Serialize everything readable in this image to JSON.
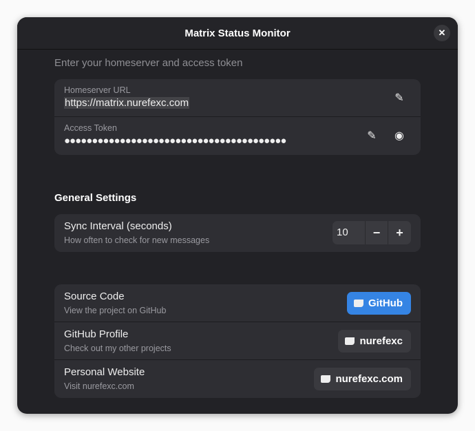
{
  "window": {
    "title": "Matrix Status Monitor"
  },
  "account": {
    "subtitle": "Enter your homeserver and access token",
    "homeserver_label": "Homeserver URL",
    "homeserver_value": "https://matrix.nurefexc.com",
    "token_label": "Access Token",
    "token_value": "●●●●●●●●●●●●●●●●●●●●●●●●●●●●●●●●●●●●●●●●"
  },
  "general": {
    "title": "General Settings",
    "sync_title": "Sync Interval (seconds)",
    "sync_desc": "How often to check for new messages",
    "sync_value": "10",
    "minus": "−",
    "plus": "+"
  },
  "links": [
    {
      "title": "Source Code",
      "desc": "View the project on GitHub",
      "button": "GitHub"
    },
    {
      "title": "GitHub Profile",
      "desc": "Check out my other projects",
      "button": "nurefexc"
    },
    {
      "title": "Personal Website",
      "desc": "Visit nurefexc.com",
      "button": "nurefexc.com"
    }
  ],
  "colors": {
    "accent": "#3584e4",
    "window_bg": "#222226",
    "card_bg": "#2e2e33"
  }
}
